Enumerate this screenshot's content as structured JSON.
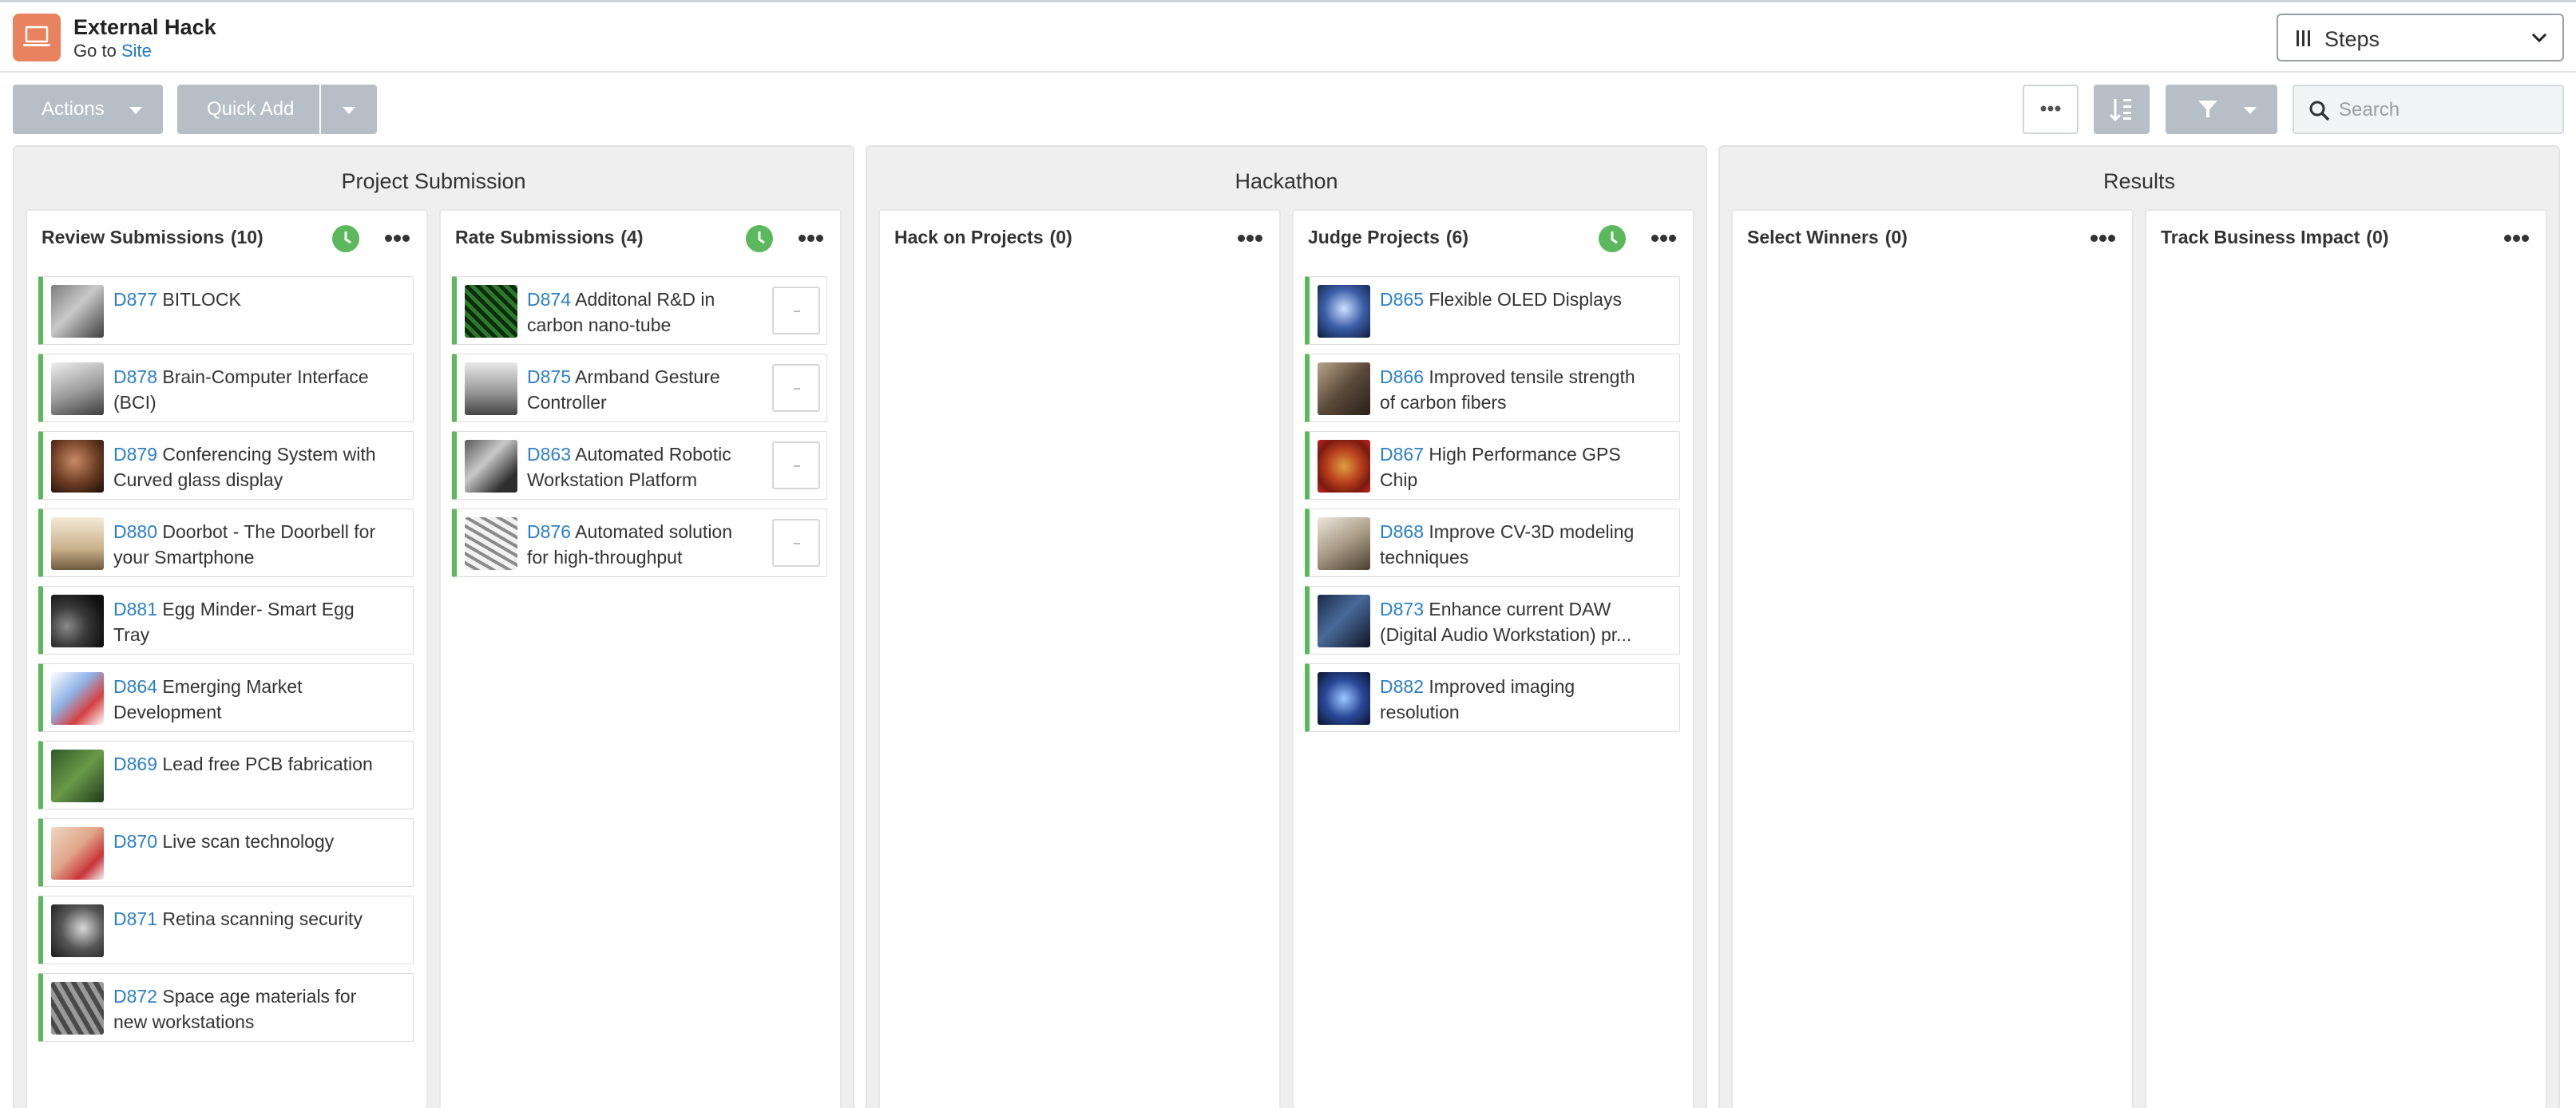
{
  "header": {
    "app_title": "External Hack",
    "goto_prefix": "Go to",
    "goto_link": "Site",
    "view_select": "Steps"
  },
  "toolbar": {
    "actions_label": "Actions",
    "quick_add_label": "Quick Add",
    "search_placeholder": "Search"
  },
  "groups": [
    {
      "title": "Project Submission"
    },
    {
      "title": "Hackathon"
    },
    {
      "title": "Results"
    }
  ],
  "columns": [
    {
      "title": "Review Submissions",
      "count": "(10)",
      "cards": [
        {
          "id": "D877",
          "title": "BITLOCK"
        },
        {
          "id": "D878",
          "title": "Brain-Computer Interface (BCI)"
        },
        {
          "id": "D879",
          "title": "Conferencing System with Curved glass display"
        },
        {
          "id": "D880",
          "title": "Doorbot - The Doorbell for your Smartphone"
        },
        {
          "id": "D881",
          "title": "Egg Minder- Smart Egg Tray"
        },
        {
          "id": "D864",
          "title": "Emerging Market Development"
        },
        {
          "id": "D869",
          "title": "Lead free PCB fabrication"
        },
        {
          "id": "D870",
          "title": "Live scan technology"
        },
        {
          "id": "D871",
          "title": "Retina scanning security"
        },
        {
          "id": "D872",
          "title": "Space age materials for new workstations"
        }
      ]
    },
    {
      "title": "Rate Submissions",
      "count": "(4)",
      "cards": [
        {
          "id": "D874",
          "title": "Additonal R&D in carbon nano-tube"
        },
        {
          "id": "D875",
          "title": "Armband Gesture Controller"
        },
        {
          "id": "D863",
          "title": "Automated Robotic Workstation Platform"
        },
        {
          "id": "D876",
          "title": "Automated solution for high-throughput"
        }
      ]
    },
    {
      "title": "Hack on Projects",
      "count": "(0)",
      "cards": []
    },
    {
      "title": "Judge Projects",
      "count": "(6)",
      "cards": [
        {
          "id": "D865",
          "title": "Flexible OLED Displays"
        },
        {
          "id": "D866",
          "title": "Improved tensile strength of carbon fibers"
        },
        {
          "id": "D867",
          "title": "High Performance GPS Chip"
        },
        {
          "id": "D868",
          "title": "Improve CV-3D modeling techniques"
        },
        {
          "id": "D873",
          "title": "Enhance current DAW (Digital Audio Workstation) pr..."
        },
        {
          "id": "D882",
          "title": "Improved imaging resolution"
        }
      ]
    },
    {
      "title": "Select Winners",
      "count": "(0)",
      "cards": []
    },
    {
      "title": "Track Business Impact",
      "count": "(0)",
      "cards": []
    }
  ],
  "colors": {
    "accent_orange": "#e8825f",
    "status_green": "#5cb85c",
    "link_blue": "#2a7fc9",
    "button_gray": "#b7bec6"
  }
}
